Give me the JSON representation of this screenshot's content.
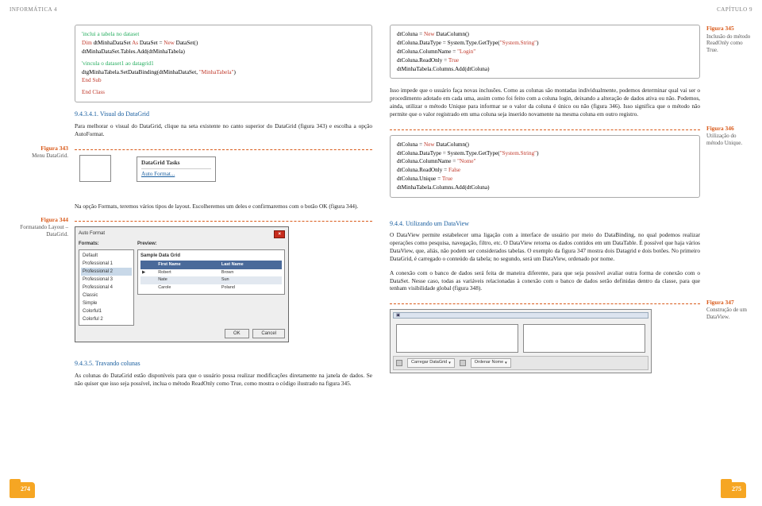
{
  "header": {
    "left": "INFORMÁTICA 4",
    "right": "CAPÍTULO 9"
  },
  "left_col": {
    "code1": {
      "c1": "'inclui a tabela no dataset",
      "l2a": "Dim",
      "l2b": " dtMinhaDataSet ",
      "l2c": "As",
      "l2d": " DataSet = ",
      "l2e": "New",
      "l2f": " DataSet()",
      "l3": "dtMinhaDataSet.Tables.Add(dtMinhaTabela)",
      "c2": "'vincula o dataset1 ao datagrid1",
      "l5": "dtgMinhaTabela.SetDataBinding(dtMinhaDataSet, ",
      "l5s": "\"MinhaTabela\"",
      "l5e": ")",
      "l6": "End Sub",
      "l7": "End Class"
    },
    "sec1_title": "9.4.3.4.1. Visual do DataGrid",
    "para1": "Para melhorar o visual do DataGrid, clique na seta existente no canto superior do DataGrid (figura 343) e escolha a opção AutoFormat.",
    "fig343": {
      "label": "Figura 343",
      "caption": "Menu DataGrid."
    },
    "tasks": {
      "title": "DataGrid Tasks",
      "link": "Auto Format..."
    },
    "para2": "Na opção Formats, teremos vários tipos de layout. Escolheremos um deles e confirmaremos com o botão OK (figura 344).",
    "fig344": {
      "label": "Figura 344",
      "caption": "Formatando Layout – DataGrid."
    },
    "autofmt": {
      "title": "Auto Format",
      "lbl_formats": "Formats:",
      "lbl_preview": "Preview:",
      "items": [
        "Default",
        "Professional 1",
        "Professional 2",
        "Professional 3",
        "Professional 4",
        "Classic",
        "Simple",
        "Colorful1",
        "Colorful 2"
      ],
      "selected": "Professional 2",
      "preview_title": "Sample Data Grid",
      "cols": [
        "",
        "First Name",
        "Last Name"
      ],
      "rows": [
        [
          "▶",
          "Robert",
          "Brown"
        ],
        [
          "",
          "Nate",
          "Sun"
        ],
        [
          "",
          "Carole",
          "Poland"
        ]
      ],
      "ok": "OK",
      "cancel": "Cancel"
    },
    "sec2_title": "9.4.3.5. Travando colunas",
    "para3": "As colunas do DataGrid estão disponíveis para que o usuário possa realizar modificações diretamente na janela de dados. Se não quiser que isso seja possível, inclua o método ReadOnly como True, como mostra o código ilustrado na figura 345.",
    "pagenum": "274"
  },
  "right_col": {
    "fig345": {
      "label": "Figura 345",
      "caption": "Inclusão do método ReadOnly como True."
    },
    "code2": {
      "l1a": "dtColuna = ",
      "l1b": "New",
      "l1c": " DataColumn()",
      "l2a": "dtColuna.DataType = System.Type.GetType(",
      "l2b": "\"System.String\"",
      "l2c": ")",
      "l3a": "dtColuna.ColumnName = ",
      "l3b": "\"Login\"",
      "l4a": "dtColuna.ReadOnly = ",
      "l4b": "True",
      "l5": "dtMinhaTabela.Columns.Add(dtColuna)"
    },
    "para4": "Isso impede que o usuário faça novas inclusões. Como as colunas são montadas individualmente, podemos determinar qual vai ser o procedimento adotado em cada uma, assim como foi feito com a coluna login, deixando a alteração de dados ativa ou não. Podemos, ainda, utilizar o método Unique para informar se o valor da coluna é único ou não (figura 346). Isso significa que o método não permite que o valor registrado em uma coluna seja inserido novamente na mesma coluna em outro registro.",
    "fig346": {
      "label": "Figura 346",
      "caption": "Utilização do método Unique."
    },
    "code3": {
      "l1a": "dtColuna = ",
      "l1b": "New",
      "l1c": " DataColumn()",
      "l2a": "dtColuna.DataType = System.Type.GetType(",
      "l2b": "\"System.String\"",
      "l2c": ")",
      "l3a": "dtColuna.ColumnName = ",
      "l3b": "\"Nome\"",
      "l4a": "dtColuna.ReadOnly = ",
      "l4b": "False",
      "l5a": "dtColuna.Unique = ",
      "l5b": "True",
      "l6": "dtMinhaTabela.Columns.Add(dtColuna)"
    },
    "sec3_title": "9.4.4. Utilizando um DataView",
    "para5": "O DataView permite estabelecer uma ligação com a interface de usuário por meio do DataBinding, no qual podemos realizar operações como pesquisa, navegação, filtro, etc. O DataView retorna os dados contidos em um DataTable. É possível que haja vários DataView, que, aliás, não podem ser considerados tabelas. O exemplo da figura 347 mostra dois Datagrid e dois botões. No primeiro DataGrid, é carregado o conteúdo da tabela; no segundo, será um DataView, ordenado por nome.",
    "para6": "A conexão com o banco de dados será feita de maneira diferente, para que seja possível avaliar outra forma de conexão com o DataSet. Nesse caso, todas as variáveis relacionadas à conexão com o banco de dados serão definidas dentro da classe, para que tenham visibilidade global (figura 348).",
    "fig347": {
      "label": "Figura 347",
      "caption": "Construção de um DataView."
    },
    "dataview": {
      "btns": [
        "Carregar DataGrid",
        "Ordenar Nome"
      ]
    },
    "pagenum": "275"
  }
}
